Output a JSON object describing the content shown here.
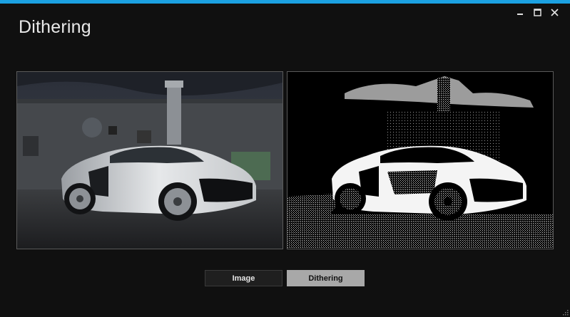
{
  "window": {
    "title": "Dithering",
    "accent_color": "#1ba1e2",
    "controls": [
      {
        "name": "minimize-icon"
      },
      {
        "name": "maximize-icon"
      },
      {
        "name": "close-icon"
      }
    ]
  },
  "images": {
    "original": {
      "subject": "silver sports car in front of an industrial building"
    },
    "dithered": {
      "subject": "dithered black and white version of the car photo"
    }
  },
  "toolbar": {
    "image_label": "Image",
    "dithering_label": "Dithering",
    "active": "Dithering"
  }
}
